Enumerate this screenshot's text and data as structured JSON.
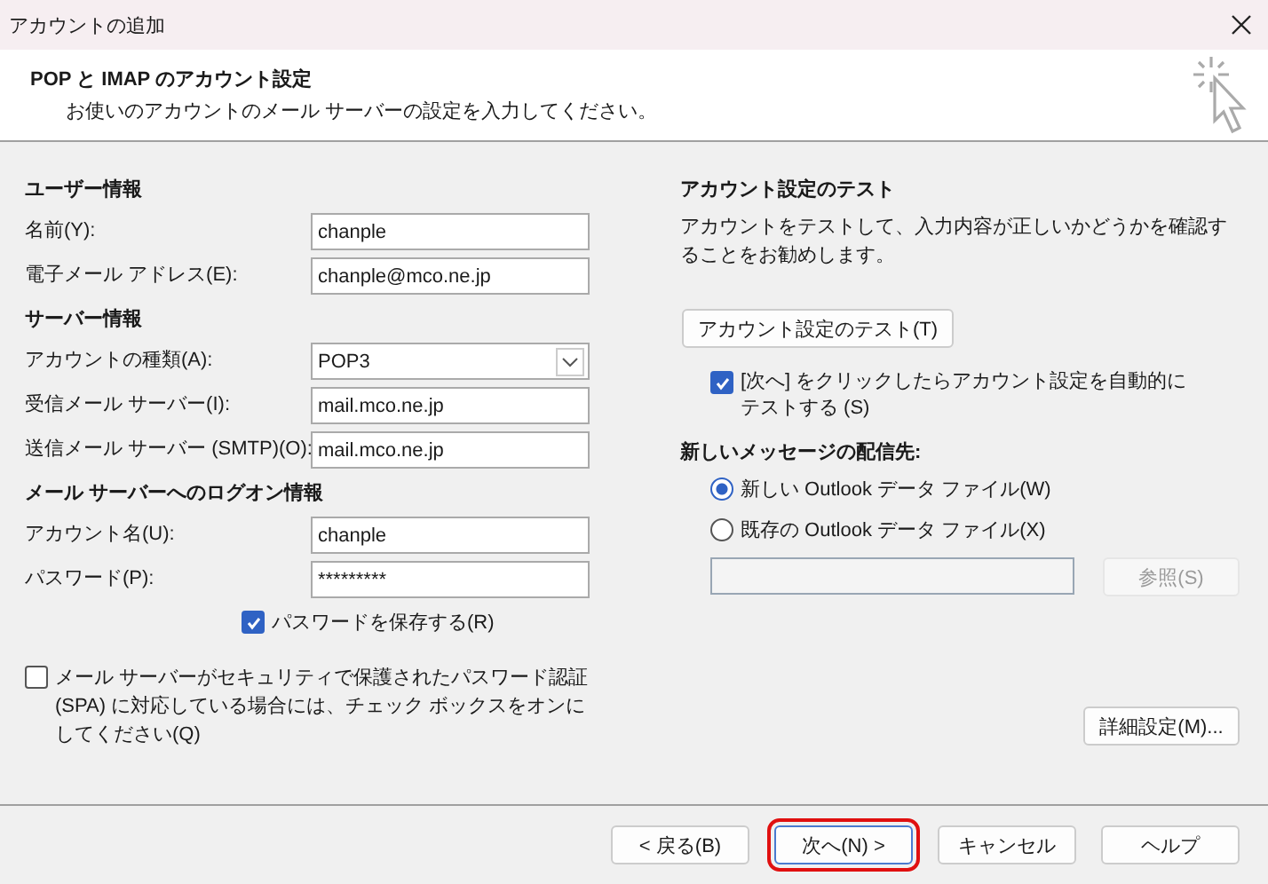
{
  "window": {
    "title": "アカウントの追加"
  },
  "header": {
    "title": "POP と IMAP のアカウント設定",
    "subtitle": "お使いのアカウントのメール サーバーの設定を入力してください。"
  },
  "left": {
    "sections": [
      {
        "heading": "ユーザー情報",
        "fields": [
          {
            "kind": "text",
            "label": "名前(Y):",
            "value": "chanple"
          },
          {
            "kind": "text",
            "label": "電子メール アドレス(E):",
            "value": "chanple@mco.ne.jp"
          }
        ]
      },
      {
        "heading": "サーバー情報",
        "fields": [
          {
            "kind": "dropdown",
            "label": "アカウントの種類(A):",
            "value": "POP3"
          },
          {
            "kind": "text",
            "label": "受信メール サーバー(I):",
            "value": "mail.mco.ne.jp"
          },
          {
            "kind": "text",
            "label": "送信メール サーバー (SMTP)(O):",
            "value": "mail.mco.ne.jp"
          }
        ]
      },
      {
        "heading": "メール サーバーへのログオン情報",
        "fields": [
          {
            "kind": "text",
            "label": "アカウント名(U):",
            "value": "chanple"
          },
          {
            "kind": "text",
            "label": "パスワード(P):",
            "value": "*********"
          }
        ]
      }
    ],
    "save_password": {
      "label": "パスワードを保存する(R)",
      "checked": true
    },
    "spa": {
      "label": "メール サーバーがセキュリティで保護されたパスワード認証 (SPA) に対応している場合には、チェック ボックスをオンにしてください(Q)",
      "checked": false
    }
  },
  "right": {
    "heading": "アカウント設定のテスト",
    "description": "アカウントをテストして、入力内容が正しいかどうかを確認することをお勧めします。",
    "test_button": "アカウント設定のテスト(T)",
    "auto_test": {
      "label": "[次へ] をクリックしたらアカウント設定を自動的にテストする (S)",
      "checked": true
    },
    "delivery_heading": "新しいメッセージの配信先:",
    "delivery_options": [
      {
        "label": "新しい Outlook データ ファイル(W)",
        "selected": true
      },
      {
        "label": "既存の Outlook データ ファイル(X)",
        "selected": false
      }
    ],
    "browse_button": {
      "label": "参照(S)",
      "disabled": true
    },
    "advanced_button": "詳細設定(M)..."
  },
  "buttons": [
    {
      "label": "< 戻る(B)",
      "highlighted": false
    },
    {
      "label": "次へ(N) >",
      "highlighted": true
    },
    {
      "label": "キャンセル",
      "highlighted": false
    },
    {
      "label": "ヘルプ",
      "highlighted": false
    }
  ]
}
